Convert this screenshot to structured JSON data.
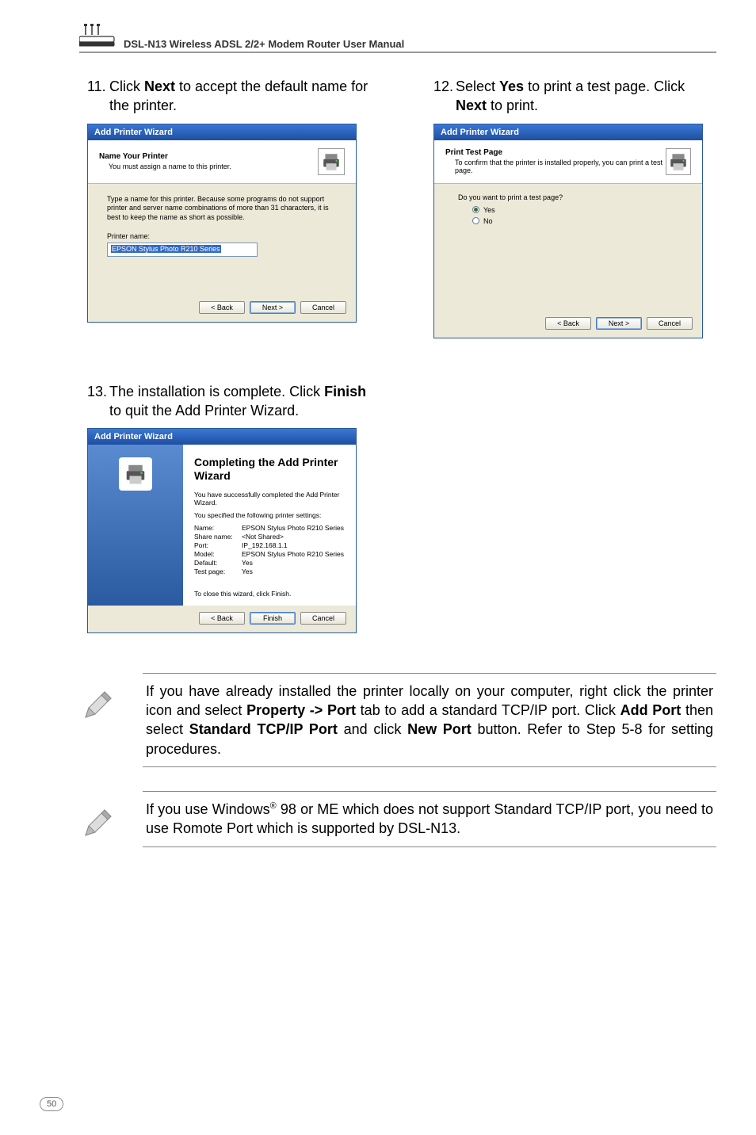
{
  "header": {
    "title": "DSL-N13 Wireless ADSL 2/2+ Modem Router User Manual"
  },
  "step11": {
    "num": "11.",
    "pre": "Click ",
    "bold": "Next",
    "post": " to accept the default name for the printer."
  },
  "step12": {
    "num": "12.",
    "pre": "Select ",
    "bold1": "Yes",
    "mid": " to print a test page. Click ",
    "bold2": "Next",
    "post": " to print."
  },
  "step13": {
    "num": "13.",
    "pre": "The installation is complete. Click ",
    "bold": "Finish",
    "post": " to quit the Add Printer Wizard."
  },
  "dlg1": {
    "title": "Add Printer Wizard",
    "h1": "Name Your Printer",
    "h2": "You must assign a name to this printer.",
    "body": "Type a name for this printer. Because some programs do not support printer and server name combinations of more than 31 characters, it is best to keep the name as short as possible.",
    "label": "Printer name:",
    "value": "EPSON Stylus Photo R210 Series",
    "back": "< Back",
    "next": "Next >",
    "cancel": "Cancel"
  },
  "dlg2": {
    "title": "Add Printer Wizard",
    "h1": "Print Test Page",
    "h2": "To confirm that the printer is installed properly, you can print a test page.",
    "q": "Do you want to print a test page?",
    "yes": "Yes",
    "no": "No",
    "back": "< Back",
    "next": "Next >",
    "cancel": "Cancel"
  },
  "dlg3": {
    "title": "Add Printer Wizard",
    "h1": "Completing the Add Printer Wizard",
    "desc1": "You have successfully completed the Add Printer Wizard.",
    "desc2": "You specified the following printer settings:",
    "rows": {
      "name_k": "Name:",
      "name_v": "EPSON Stylus Photo R210 Series",
      "share_k": "Share name:",
      "share_v": "<Not Shared>",
      "port_k": "Port:",
      "port_v": "IP_192.168.1.1",
      "model_k": "Model:",
      "model_v": "EPSON Stylus Photo R210 Series",
      "default_k": "Default:",
      "default_v": "Yes",
      "test_k": "Test page:",
      "test_v": "Yes"
    },
    "close": "To close this wizard, click Finish.",
    "back": "< Back",
    "finish": "Finish",
    "cancel": "Cancel"
  },
  "note1": {
    "p1": "If you have already installed the printer locally on your computer, right click the printer icon and select ",
    "b1": "Property -> Port",
    "p2": " tab to add a standard TCP/IP port. Click ",
    "b2": "Add Port",
    "p3": " then select ",
    "b3": "Standard TCP/IP Port",
    "p4": " and click ",
    "b4": "New Port",
    "p5": " button. Refer to Step 5-8 for setting procedures."
  },
  "note2": {
    "p1": "If you use Windows",
    "sup": "®",
    "p2": " 98 or ME which does not support Standard TCP/IP port, you need to use Romote Port which is supported by DSL-N13."
  },
  "pagenum": "50"
}
